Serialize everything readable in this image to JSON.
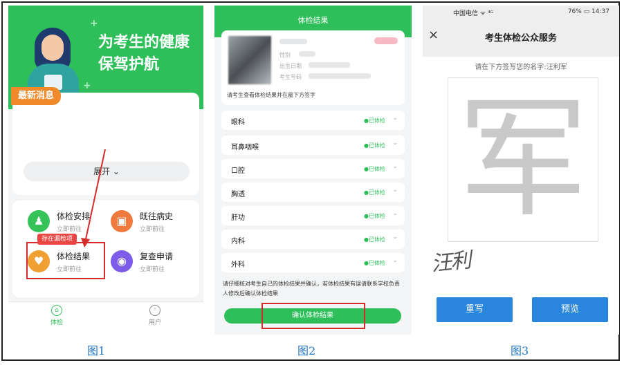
{
  "figure1": {
    "caption": "图1",
    "slogan": "为考生的健康\n保驾护航",
    "news_tag": "最新消息",
    "expand_label": "展开 ⌄",
    "grid": [
      {
        "title": "体检安排",
        "sub": "立即前往",
        "color": "#34c259",
        "icon": "person-icon"
      },
      {
        "title": "既往病史",
        "sub": "立即前往",
        "color": "#ee7a3c",
        "icon": "medical-record-icon"
      },
      {
        "title": "体检结果",
        "sub": "立即前往",
        "color": "#f0a032",
        "icon": "result-icon"
      },
      {
        "title": "复查申请",
        "sub": "立即前往",
        "color": "#7c5ce8",
        "icon": "eye-icon"
      }
    ],
    "warning_badge": "存在漏检项",
    "tabs": [
      {
        "label": "体检",
        "active": true
      },
      {
        "label": "用户",
        "active": false
      }
    ]
  },
  "figure2": {
    "caption": "图2",
    "header_title": "体检结果",
    "profile_labels": [
      "性别",
      "出生日期",
      "考生号码"
    ],
    "profile_note": "请考生查看体检结果并在最下方签字",
    "departments": [
      {
        "name": "眼科",
        "status": "●已体检"
      },
      {
        "name": "耳鼻咽喉",
        "status": "●已体检"
      },
      {
        "name": "口腔",
        "status": "●已体检"
      },
      {
        "name": "胸透",
        "status": "●已体检"
      },
      {
        "name": "肝功",
        "status": "●已体检"
      },
      {
        "name": "内科",
        "status": "●已体检"
      },
      {
        "name": "外科",
        "status": "●已体检"
      }
    ],
    "footer_note": "请仔细核对考生自己的体检结果并确认，若体检结果有误请联系学校负责人修改后确认体检结果",
    "confirm_button": "确认体检结果"
  },
  "figure3": {
    "caption": "图3",
    "status_left": "中国电信 ᯤ ⁴ᴳ",
    "status_right": "76% ▭ 14:37",
    "nav_title": "考生体检公众服务",
    "close_symbol": "×",
    "hint": "请在下方签写您的名字:汪利军",
    "pad_char": "军",
    "signature": "汪利",
    "rewrite_button": "重写",
    "preview_button": "预览"
  },
  "colors": {
    "brand_green": "#2fbf5a",
    "highlight_red": "#d52b2b",
    "button_blue": "#2a86dd",
    "caption_blue": "#1f76c8"
  }
}
